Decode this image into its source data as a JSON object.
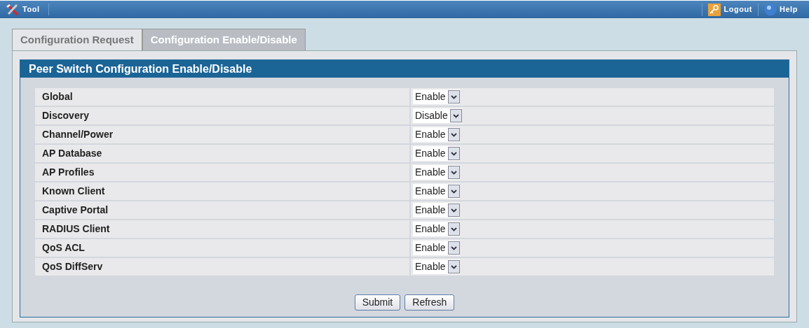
{
  "top_bar": {
    "title": "Tool",
    "links": [
      {
        "kind": "logout",
        "label": "Logout"
      },
      {
        "kind": "help",
        "label": "Help"
      }
    ]
  },
  "tabs": [
    {
      "label": "Configuration Request",
      "selected": false
    },
    {
      "label": "Configuration Enable/Disable",
      "selected": true
    }
  ],
  "panel": {
    "title": "Peer Switch Configuration Enable/Disable"
  },
  "rows": [
    {
      "label": "Global",
      "value": "Enable"
    },
    {
      "label": "Discovery",
      "value": "Disable"
    },
    {
      "label": "Channel/Power",
      "value": "Enable"
    },
    {
      "label": "AP Database",
      "value": "Enable"
    },
    {
      "label": "AP Profiles",
      "value": "Enable"
    },
    {
      "label": "Known Client",
      "value": "Enable"
    },
    {
      "label": "Captive Portal",
      "value": "Enable"
    },
    {
      "label": "RADIUS Client",
      "value": "Enable"
    },
    {
      "label": "QoS ACL",
      "value": "Enable"
    },
    {
      "label": "QoS DiffServ",
      "value": "Enable"
    }
  ],
  "buttons": [
    "Submit",
    "Refresh"
  ]
}
